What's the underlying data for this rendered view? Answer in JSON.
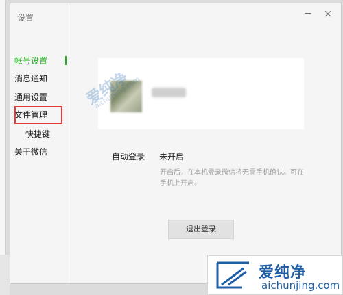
{
  "window": {
    "title": "设置",
    "minimize_glyph": "−",
    "close_glyph": "×"
  },
  "sidebar": {
    "items": [
      {
        "label": "帐号设置",
        "active": true
      },
      {
        "label": "消息通知"
      },
      {
        "label": "通用设置"
      },
      {
        "label": "文件管理",
        "highlighted": true
      },
      {
        "label": "快捷键"
      },
      {
        "label": "关于微信"
      }
    ]
  },
  "account": {
    "auto_login_label": "自动登录",
    "auto_login_value": "未开启",
    "auto_login_desc": "开启后，在本机登录微信将无需手机确认。可在手机上开启。",
    "logout_label": "退出登录"
  },
  "watermark": {
    "brand_zh": "爱纯净",
    "brand_en": "aichunjing.com",
    "color": "#1f5fa8"
  },
  "colors": {
    "accent": "#1aad19",
    "highlight": "#e53935"
  }
}
